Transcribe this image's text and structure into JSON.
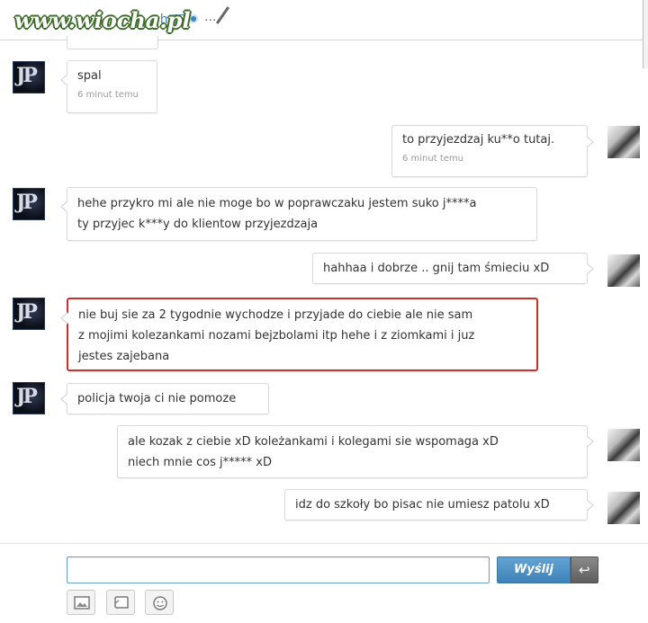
{
  "header": {
    "watermark": "www.wiocha.pl",
    "name_fragment": "h JP",
    "menu_dots": "..."
  },
  "colors": {
    "accent": "#3e86c2",
    "highlight_border": "#c9302c",
    "watermark_outline": "#3d6b2a"
  },
  "messages": [
    {
      "side": "left",
      "text": "spal",
      "time": "6 minut temu"
    },
    {
      "side": "right",
      "text": "to przyjezdzaj ku**o tutaj.",
      "time": "6 minut temu"
    },
    {
      "side": "left",
      "lines": [
        "hehe przykro mi ale nie moge bo w poprawczaku jestem suko j****a",
        "ty przyjec k***y do klientow przyjezdzaja"
      ]
    },
    {
      "side": "right",
      "text": "hahhaa i dobrze .. gnij tam śmieciu xD"
    },
    {
      "side": "left",
      "highlighted": true,
      "lines": [
        "nie buj sie za 2 tygodnie wychodze i przyjade do ciebie ale nie sam",
        "z mojimi kolezankami nozami bejzbolami itp hehe i z ziomkami i juz",
        "jestes zajebana"
      ]
    },
    {
      "side": "left",
      "text": "policja twoja ci nie pomoze"
    },
    {
      "side": "right",
      "lines": [
        "ale kozak z ciebie xD koleżankami i kolegami sie wspomaga xD",
        "niech mnie cos j***** xD"
      ]
    },
    {
      "side": "right",
      "text": "idz do szkoły bo pisac nie umiesz patolu xD"
    }
  ],
  "composer": {
    "input_value": "",
    "send_label": "Wyślij",
    "tools": [
      "image-icon",
      "sticker-icon",
      "smiley-icon"
    ]
  },
  "icons": {
    "enter": "return-arrow-icon",
    "status": "online-dot-icon",
    "edit": "pencil-icon"
  }
}
